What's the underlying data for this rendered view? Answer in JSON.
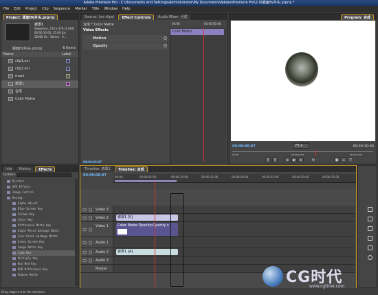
{
  "window": {
    "title": "Adobe Premiere Pro - C:\\Documents and Settings\\Administrator\\My Documents\\Adobe\\Premiere Pro\\2.0\\版面0V片头.prproj *"
  },
  "menu": [
    "File",
    "Edit",
    "Project",
    "Clip",
    "Sequence",
    "Marker",
    "Title",
    "Window",
    "Help"
  ],
  "project": {
    "tab": "Project: 版面0V片头.prproj",
    "clip_name": "遮罩1",
    "info": [
      "Sequence, 720 x 576 (1.067)",
      "00:00:10:00, 25.00 fps",
      "32000 Hz - Stereo - A..."
    ],
    "bin": "版面0V片头.prproj",
    "count": "6 Items",
    "col_name": "Name",
    "col_label": "Label",
    "items": [
      "clip1.avi",
      "clip2.avi",
      "mask",
      "遮罩1",
      "合成",
      "Color Matte"
    ]
  },
  "effect_controls": {
    "tabs": [
      "Source: (no clips)",
      "Effect Controls",
      "Audio Mixer: 合成"
    ],
    "header": "合成 * Color Matte",
    "section": "Video Effects",
    "effects": [
      "Motion",
      "Opacity"
    ],
    "mini_tc": "00:00:05:00",
    "mini_tc2": "00:00",
    "clip_label": "Color Matte",
    "timecode": "00:00:05:07"
  },
  "program": {
    "tab": "Program: 合成",
    "timecode": "00:00:06:07",
    "fit": "Fit",
    "duration": "00:00:10:00",
    "ruler": [
      "00:00",
      "00:00:05:00",
      "00:00:10:00"
    ]
  },
  "effects_panel": {
    "tabs": [
      "Info",
      "History",
      "Effects"
    ],
    "search_label": "Contains:",
    "items": [
      "Distort",
      "GPU Effects",
      "Image Control",
      "Keying",
      "Alpha Adjust",
      "Blue Screen Key",
      "Chroma Key",
      "Color Key",
      "Difference Matte Key",
      "Eight-Point Garbage Matte",
      "Four-Point Garbage Matte",
      "Green Screen Key",
      "Image Matte Key",
      "Luma Key",
      "Multiply Key",
      "Non Red Key",
      "RGB Difference Key",
      "Remove Matte"
    ]
  },
  "timeline": {
    "tabs": [
      "Timeline: 遮罩1",
      "Timeline: 合成"
    ],
    "timecode": "00:00:06:07",
    "ruler": [
      "00:00",
      "00:00:05:00",
      "00:00:10:00",
      "00:00:15:00",
      "00:00:20:00",
      "00:00:25:00",
      "00:00:30:00",
      "00:00:35:00"
    ],
    "tracks": {
      "v3": "Video 3",
      "v2": "Video 2",
      "v1": "Video 1",
      "a1": "Audio 1",
      "a2": "Audio 2",
      "a3": "Audio 3",
      "master": "Master"
    },
    "clips": {
      "v2": "遮罩1 [V]",
      "v1": "Color Matte  Opacity:Opacity ▾",
      "a2": "遮罩1 [A]"
    }
  },
  "status": "Drag edge to trim the selection.",
  "watermark": {
    "logo": "CG时代",
    "url": "www.cgtime.com"
  }
}
